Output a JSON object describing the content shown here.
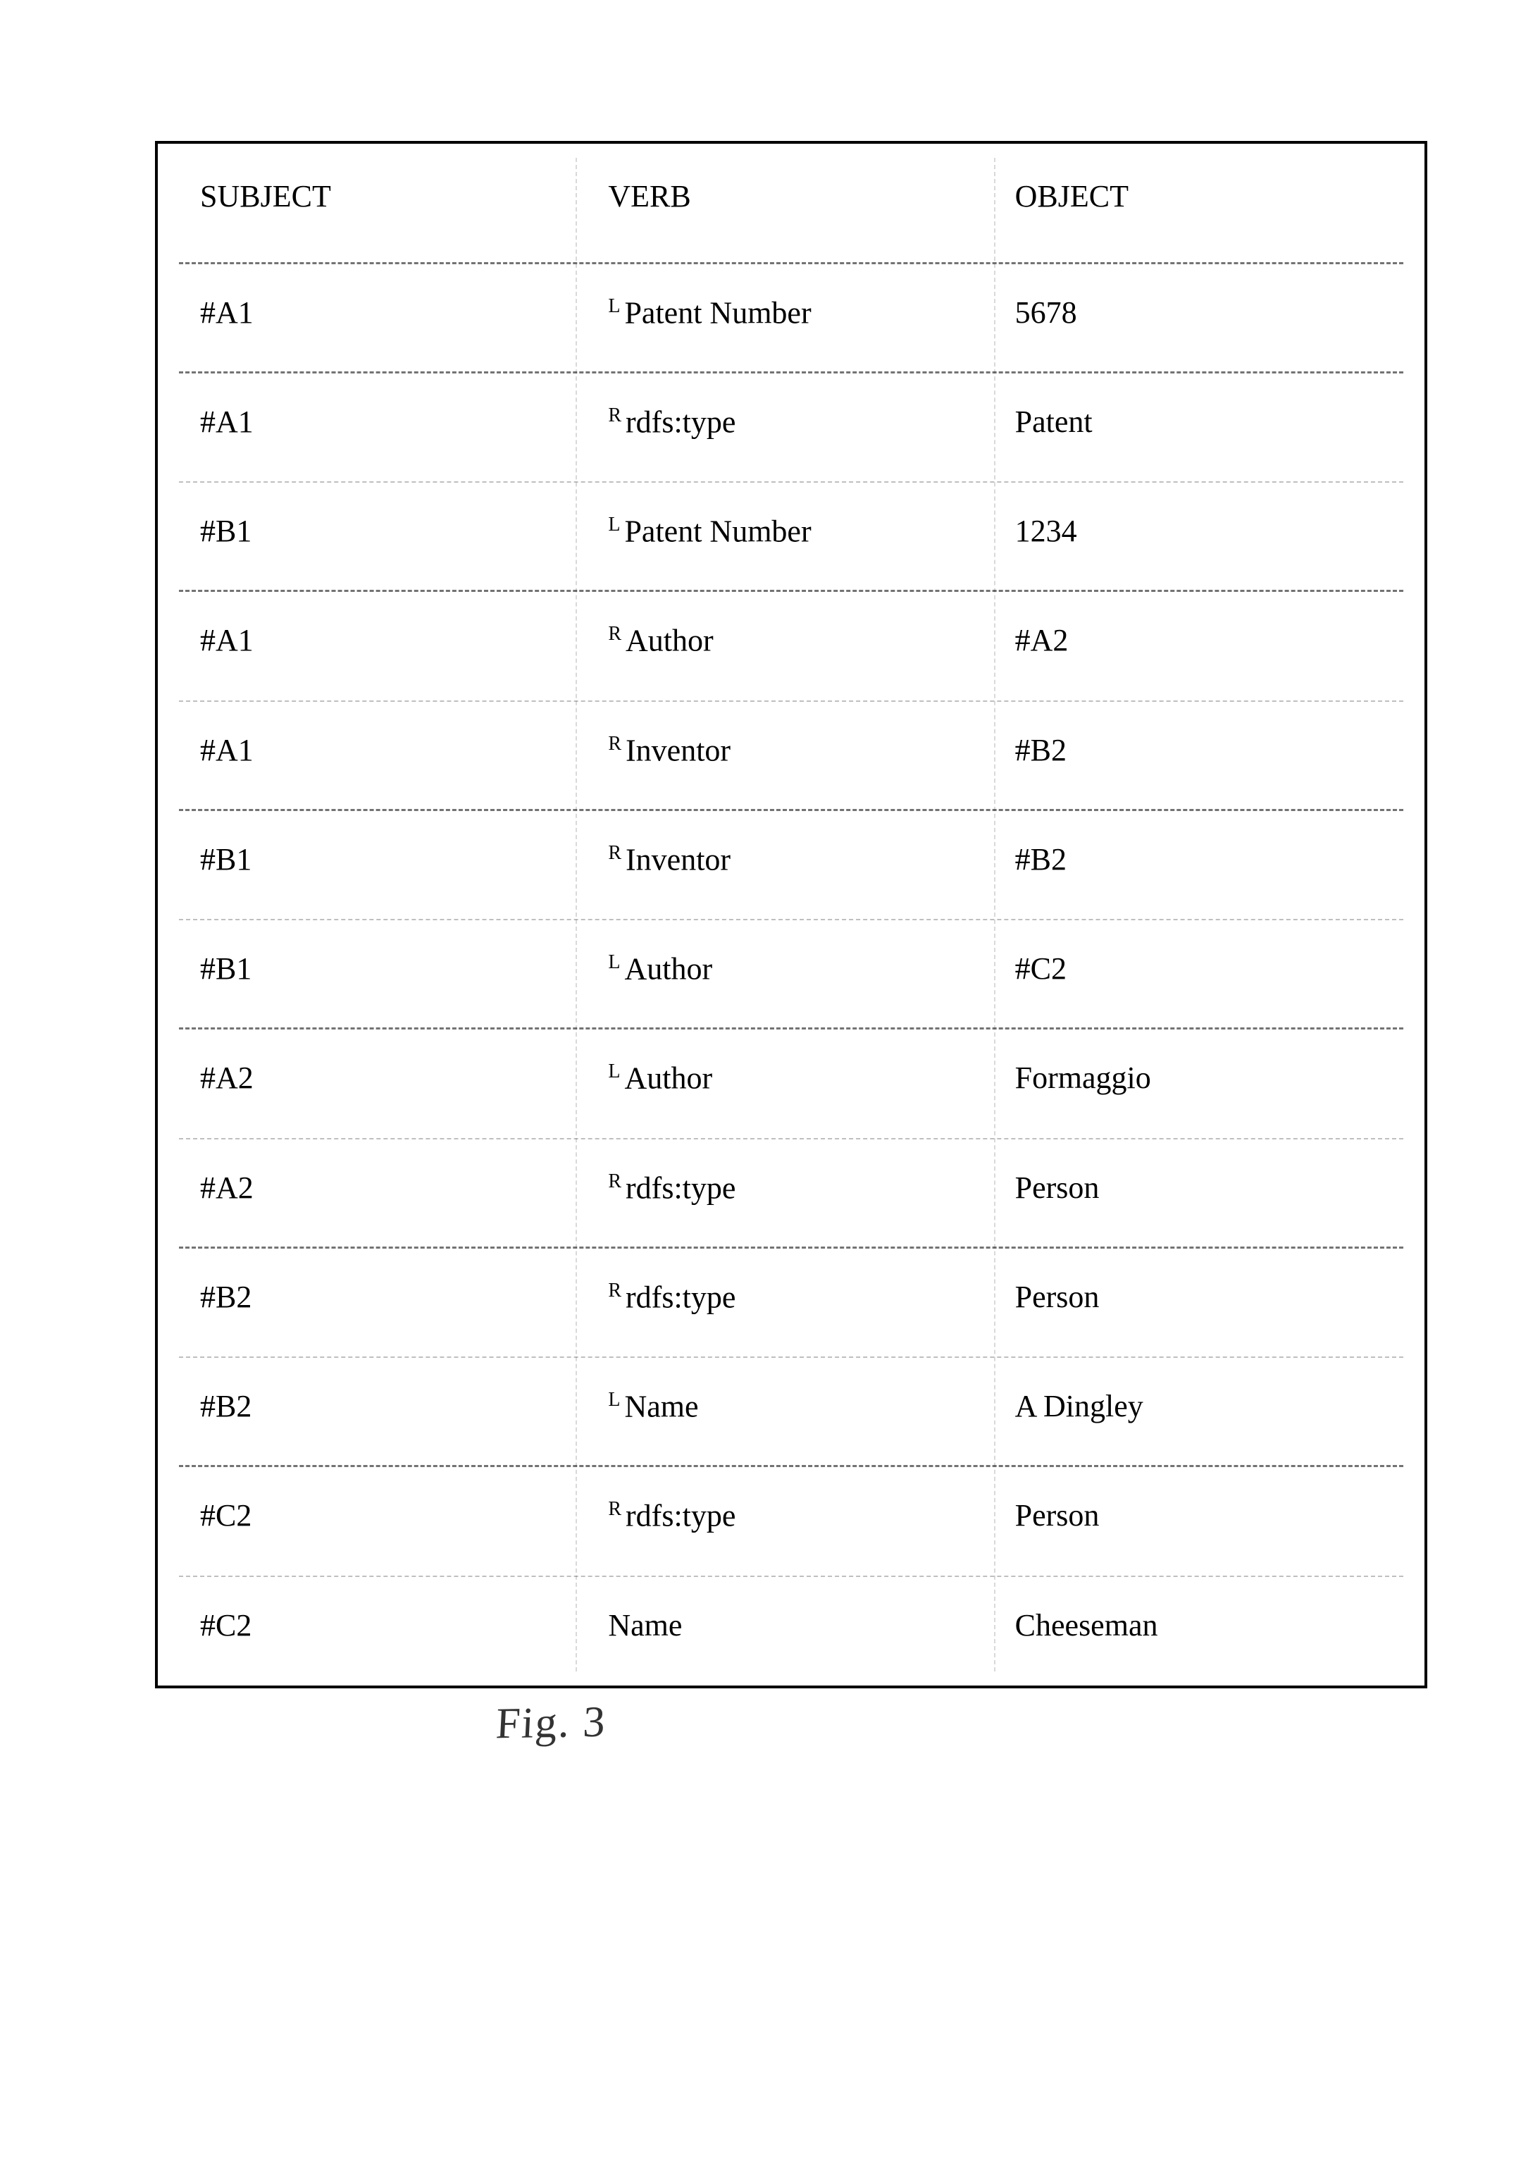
{
  "caption": "Fig. 3",
  "header": {
    "subject": "SUBJECT",
    "verb": "VERB",
    "object": "OBJECT"
  },
  "rows": [
    {
      "subject": "#A1",
      "sup": "L",
      "verb": "Patent Number",
      "object": "5678"
    },
    {
      "subject": "#A1",
      "sup": "R",
      "verb": "rdfs:type",
      "object": "Patent"
    },
    {
      "subject": "#B1",
      "sup": "L",
      "verb": "Patent Number",
      "object": "1234"
    },
    {
      "subject": "#A1",
      "sup": "R",
      "verb": "Author",
      "object": "#A2"
    },
    {
      "subject": "#A1",
      "sup": "R",
      "verb": "Inventor",
      "object": "#B2"
    },
    {
      "subject": "#B1",
      "sup": "R",
      "verb": "Inventor",
      "object": "#B2"
    },
    {
      "subject": "#B1",
      "sup": "L",
      "verb": "Author",
      "object": "#C2"
    },
    {
      "subject": "#A2",
      "sup": "L",
      "verb": "Author",
      "object": "Formaggio"
    },
    {
      "subject": "#A2",
      "sup": "R",
      "verb": "rdfs:type",
      "object": "Person"
    },
    {
      "subject": "#B2",
      "sup": "R",
      "verb": "rdfs:type",
      "object": "Person"
    },
    {
      "subject": "#B2",
      "sup": "L",
      "verb": "Name",
      "object": "A Dingley"
    },
    {
      "subject": "#C2",
      "sup": "R",
      "verb": "rdfs:type",
      "object": "Person"
    },
    {
      "subject": "#C2",
      "sup": "",
      "verb": "Name",
      "object": "Cheeseman"
    }
  ]
}
